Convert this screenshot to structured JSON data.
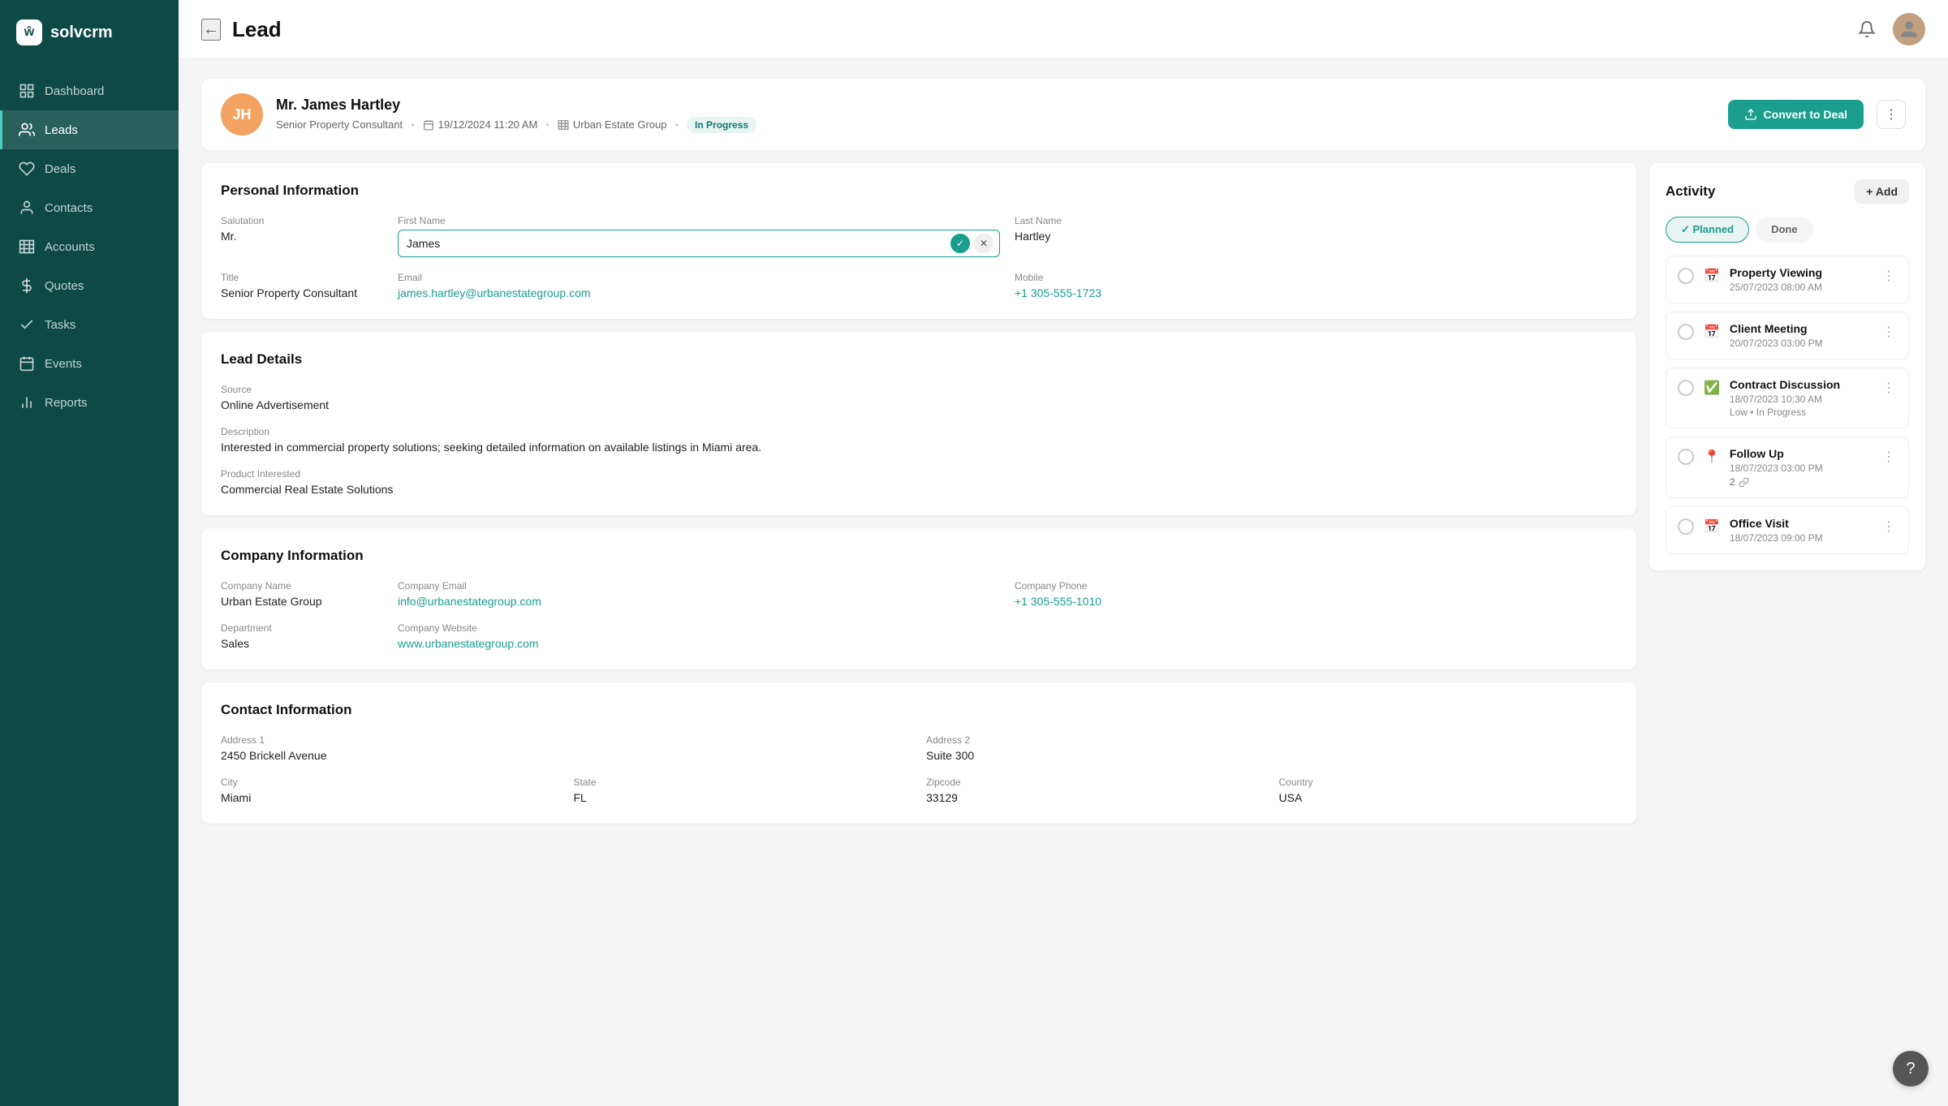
{
  "app": {
    "name": "solvcrm",
    "logo_text": "ŵ"
  },
  "sidebar": {
    "items": [
      {
        "id": "dashboard",
        "label": "Dashboard",
        "icon": "grid"
      },
      {
        "id": "leads",
        "label": "Leads",
        "icon": "users",
        "active": true
      },
      {
        "id": "deals",
        "label": "Deals",
        "icon": "handshake"
      },
      {
        "id": "contacts",
        "label": "Contacts",
        "icon": "person"
      },
      {
        "id": "accounts",
        "label": "Accounts",
        "icon": "building"
      },
      {
        "id": "quotes",
        "label": "Quotes",
        "icon": "dollar"
      },
      {
        "id": "tasks",
        "label": "Tasks",
        "icon": "check"
      },
      {
        "id": "events",
        "label": "Events",
        "icon": "calendar"
      },
      {
        "id": "reports",
        "label": "Reports",
        "icon": "chart"
      }
    ]
  },
  "header": {
    "back_label": "←",
    "title": "Lead",
    "bell_icon": "🔔",
    "avatar_initials": "👤"
  },
  "lead": {
    "initials": "JH",
    "name": "Mr. James Hartley",
    "title": "Senior Property Consultant",
    "date": "19/12/2024 11:20 AM",
    "company": "Urban Estate Group",
    "status": "In Progress",
    "convert_btn": "Convert to Deal"
  },
  "personal_info": {
    "section_title": "Personal Information",
    "salutation_label": "Salutation",
    "salutation_value": "Mr.",
    "first_name_label": "First Name",
    "first_name_value": "James",
    "last_name_label": "Last Name",
    "last_name_value": "Hartley",
    "title_label": "Title",
    "title_value": "Senior Property Consultant",
    "email_label": "Email",
    "email_value": "james.hartley@urbanestategroup.com",
    "mobile_label": "Mobile",
    "mobile_value": "+1 305-555-1723"
  },
  "lead_details": {
    "section_title": "Lead Details",
    "source_label": "Source",
    "source_value": "Online Advertisement",
    "description_label": "Description",
    "description_value": "Interested in commercial property solutions; seeking detailed information on available listings in Miami area.",
    "product_label": "Product Interested",
    "product_value": "Commercial Real Estate Solutions"
  },
  "company_info": {
    "section_title": "Company Information",
    "company_name_label": "Company Name",
    "company_name_value": "Urban Estate Group",
    "company_email_label": "Company Email",
    "company_email_value": "info@urbanestategroup.com",
    "company_phone_label": "Company Phone",
    "company_phone_value": "+1 305-555-1010",
    "department_label": "Department",
    "department_value": "Sales",
    "website_label": "Company Website",
    "website_value": "www.urbanestategroup.com"
  },
  "contact_info": {
    "section_title": "Contact Information",
    "address1_label": "Address 1",
    "address1_value": "2450 Brickell Avenue",
    "address2_label": "Address 2",
    "address2_value": "Suite 300",
    "city_label": "City",
    "city_value": "Miami",
    "state_label": "State",
    "state_value": "FL",
    "zipcode_label": "Zipcode",
    "zipcode_value": "33129",
    "country_label": "Country",
    "country_value": "USA"
  },
  "activity": {
    "title": "Activity",
    "add_btn": "+ Add",
    "tabs": [
      {
        "id": "planned",
        "label": "Planned",
        "active": true
      },
      {
        "id": "done",
        "label": "Done",
        "active": false
      }
    ],
    "items": [
      {
        "id": "property-viewing",
        "name": "Property Viewing",
        "date": "25/07/2023 08:00 AM",
        "icon": "📅",
        "meta": "",
        "links": 0
      },
      {
        "id": "client-meeting",
        "name": "Client Meeting",
        "date": "20/07/2023 03:00 PM",
        "icon": "📅",
        "meta": "",
        "links": 0
      },
      {
        "id": "contract-discussion",
        "name": "Contract Discussion",
        "date": "18/07/2023 10:30 AM",
        "icon": "✅",
        "meta": "Low • In Progress",
        "links": 0
      },
      {
        "id": "follow-up",
        "name": "Follow Up",
        "date": "18/07/2023 03:00 PM",
        "icon": "📍",
        "meta": "",
        "links": 2
      },
      {
        "id": "office-visit",
        "name": "Office Visit",
        "date": "18/07/2023 09:00 PM",
        "icon": "📅",
        "meta": "",
        "links": 0
      }
    ]
  }
}
